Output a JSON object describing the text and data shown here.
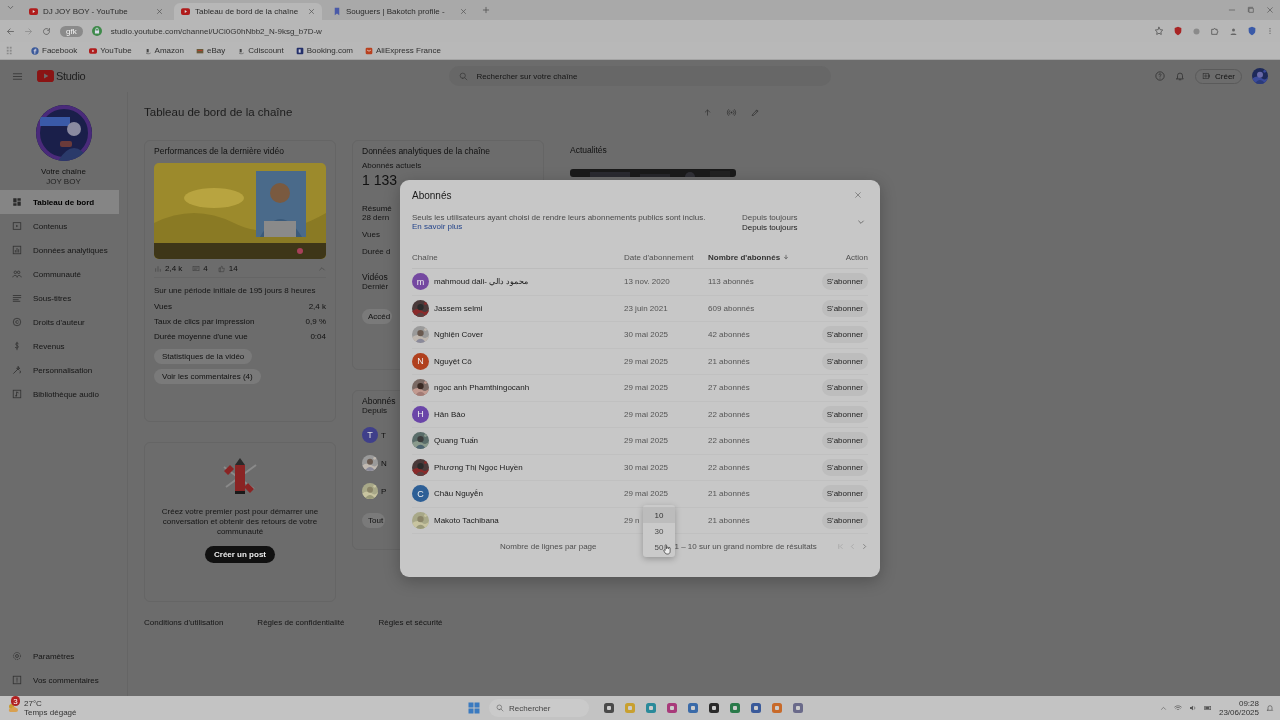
{
  "browser": {
    "tabs": [
      {
        "title": "DJ JOY BOY - YouTube",
        "selected": false
      },
      {
        "title": "Tableau de bord de la chaîne",
        "selected": true
      },
      {
        "title": "Souguers | Bakotch profile -",
        "selected": false
      }
    ],
    "site_chip": "gfk",
    "address": "studio.youtube.com/channel/UCi0G0hNbb2_N-9ksg_b7D-w",
    "bookmarks": [
      "Facebook",
      "YouTube",
      "Amazon",
      "eBay",
      "Cdiscount",
      "Booking.com",
      "AliExpress France"
    ]
  },
  "header": {
    "logo": "Studio",
    "search_placeholder": "Rechercher sur votre chaîne",
    "create": "Créer"
  },
  "sidebar": {
    "channel_label": "Votre chaîne",
    "channel_name": "JOY BOY",
    "items": [
      {
        "label": "Tableau de bord",
        "selected": true
      },
      {
        "label": "Contenus",
        "selected": false
      },
      {
        "label": "Données analytiques",
        "selected": false
      },
      {
        "label": "Communauté",
        "selected": false
      },
      {
        "label": "Sous-titres",
        "selected": false
      },
      {
        "label": "Droits d'auteur",
        "selected": false
      },
      {
        "label": "Revenus",
        "selected": false
      },
      {
        "label": "Personnalisation",
        "selected": false
      },
      {
        "label": "Bibliothèque audio",
        "selected": false
      }
    ],
    "bottom_items": [
      "Paramètres",
      "Vos commentaires"
    ]
  },
  "dashboard": {
    "title": "Tableau de bord de la chaîne",
    "latest_video": {
      "title": "Performances de la dernière vidéo",
      "stats": [
        "2,4 k",
        "4",
        "14"
      ],
      "period": "Sur une période initiale de 195 jours 8 heures",
      "metrics": [
        {
          "label": "Vues",
          "value": "2,4 k"
        },
        {
          "label": "Taux de clics par impression",
          "value": "0,9 %"
        },
        {
          "label": "Durée moyenne d'une vue",
          "value": "0:04"
        }
      ],
      "buttons": [
        "Statistiques de la vidéo",
        "Voir les commentaires (4)"
      ]
    },
    "post": {
      "text": "Créez votre premier post pour démarrer une conversation et obtenir des retours de votre communauté",
      "button": "Créer un post"
    },
    "analytics": {
      "title": "Données analytiques de la chaîne",
      "subscribers_label": "Abonnés actuels",
      "subscribers": "1 133",
      "summary_title": "Résumé",
      "summary_period": "28 dern",
      "summary_rows": [
        "Vues",
        "Durée d"
      ],
      "top_videos_title": "Vidéos",
      "top_videos_period": "Dernièr",
      "button": "Accéd"
    },
    "subscribers": {
      "title": "Abonnés",
      "period": "Depuis",
      "items": [
        {
          "kind": "letter",
          "letter": "T",
          "color": "#3f3f8a",
          "name": "T"
        },
        {
          "kind": "picture",
          "name": "N"
        },
        {
          "kind": "picture",
          "name": "P"
        }
      ],
      "button": "Tout"
    },
    "news": {
      "title": "Actualités"
    },
    "footer_links": [
      "Conditions d'utilisation",
      "Règles de confidentialité",
      "Règles et sécurité"
    ]
  },
  "modal": {
    "title": "Abonnés",
    "description": "Seuls les utilisateurs ayant choisi de rendre leurs abonnements publics sont inclus.",
    "learn_more": "En savoir plus",
    "filter": {
      "label": "Depuis toujours",
      "value": "Depuis toujours"
    },
    "columns": [
      {
        "label": "Chaîne",
        "sorted": false
      },
      {
        "label": "Date d'abonnement",
        "sorted": false
      },
      {
        "label": "Nombre d'abonnés",
        "sorted": true
      },
      {
        "label": "Action",
        "sorted": false
      }
    ],
    "rows": [
      {
        "avatar": {
          "kind": "letter",
          "letter": "m",
          "color": "#7448a0"
        },
        "name": "mahmoud dali- محمود دالي",
        "date": "13 nov. 2020",
        "subscribers": "113 abonnés",
        "action": "S'abonner"
      },
      {
        "name": "Jassem selmi",
        "date": "23 juin 2021",
        "subscribers": "609 abonnés",
        "action": "S'abonner"
      },
      {
        "name": "Nghiện Cover",
        "date": "30 mai 2025",
        "subscribers": "42 abonnés",
        "action": "S'abonner"
      },
      {
        "avatar": {
          "kind": "letter",
          "letter": "N",
          "color": "#b0401e"
        },
        "name": "Nguyệt Cô",
        "date": "29 mai 2025",
        "subscribers": "21 abonnés",
        "action": "S'abonner"
      },
      {
        "name": "ngoc anh Phamthingocanh",
        "date": "29 mai 2025",
        "subscribers": "27 abonnés",
        "action": "S'abonner"
      },
      {
        "avatar": {
          "kind": "letter",
          "letter": "H",
          "color": "#6a45a8"
        },
        "name": "Hân Bảo",
        "date": "29 mai 2025",
        "subscribers": "22 abonnés",
        "action": "S'abonner"
      },
      {
        "name": "Quang Tuấn",
        "date": "29 mai 2025",
        "subscribers": "22 abonnés",
        "action": "S'abonner"
      },
      {
        "name": "Phương Thị Ngọc Huyền",
        "date": "30 mai 2025",
        "subscribers": "22 abonnés",
        "action": "S'abonner"
      },
      {
        "avatar": {
          "kind": "letter",
          "letter": "C",
          "color": "#2d5f96"
        },
        "name": "Châu Nguyễn",
        "date": "29 mai 2025",
        "subscribers": "21 abonnés",
        "action": "S'abonner"
      },
      {
        "name": "Makoto Tachibana",
        "date": "29 n",
        "subscribers": "21 abonnés",
        "action": "S'abonner"
      }
    ],
    "footer": {
      "rows_label": "Nombre de lignes par page",
      "range": "1 – 10 sur un grand nombre de résultats"
    },
    "rows_menu": [
      {
        "label": "10",
        "selected": true
      },
      {
        "label": "30",
        "selected": false
      },
      {
        "label": "50",
        "selected": false
      }
    ]
  },
  "taskbar": {
    "weather": {
      "badge": "3",
      "temp": "27°C",
      "condition": "Temps dégagé"
    },
    "search_placeholder": "Rechercher",
    "time": "09:28",
    "date": "23/06/2025"
  }
}
